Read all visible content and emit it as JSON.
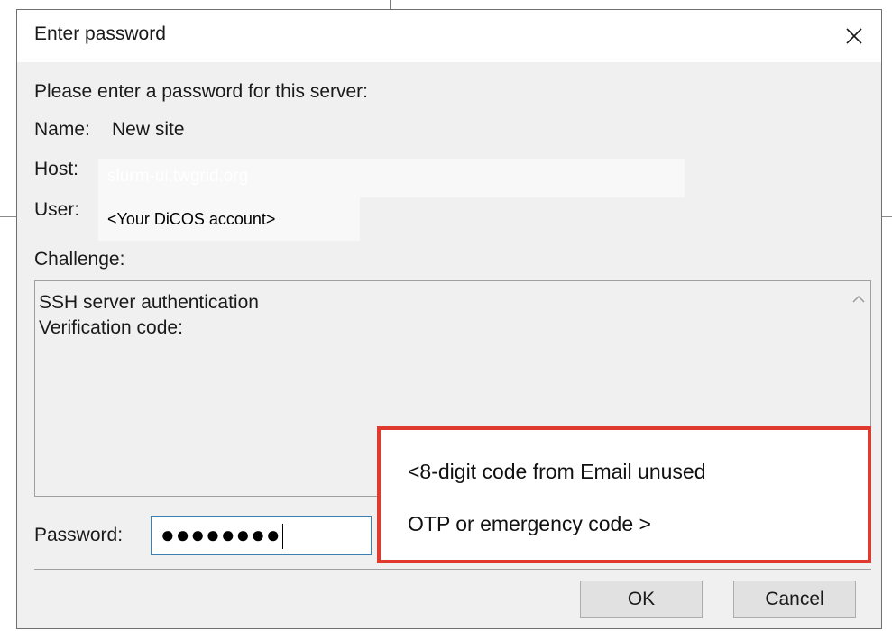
{
  "dialog": {
    "title": "Enter password",
    "prompt": "Please enter a password for this server:",
    "name_label": "Name:",
    "name_value": "New site",
    "host_label": "Host:",
    "host_value": "slurm-ui.twgrid.org",
    "user_label": "User:",
    "user_value": "<Your DiCOS account>",
    "challenge_label": "Challenge:",
    "challenge_lines": [
      "SSH server authentication",
      "Verification code:"
    ],
    "password_label": "Password:",
    "password_masked": "●●●●●●●●",
    "ok_label": "OK",
    "cancel_label": "Cancel"
  },
  "annotation": {
    "line1": "<8-digit code from Email unused",
    "line2": "OTP or emergency code >",
    "border_color": "#e03a2e"
  },
  "icons": {
    "close": "close-icon",
    "scroll_up": "chevron-up-icon"
  }
}
